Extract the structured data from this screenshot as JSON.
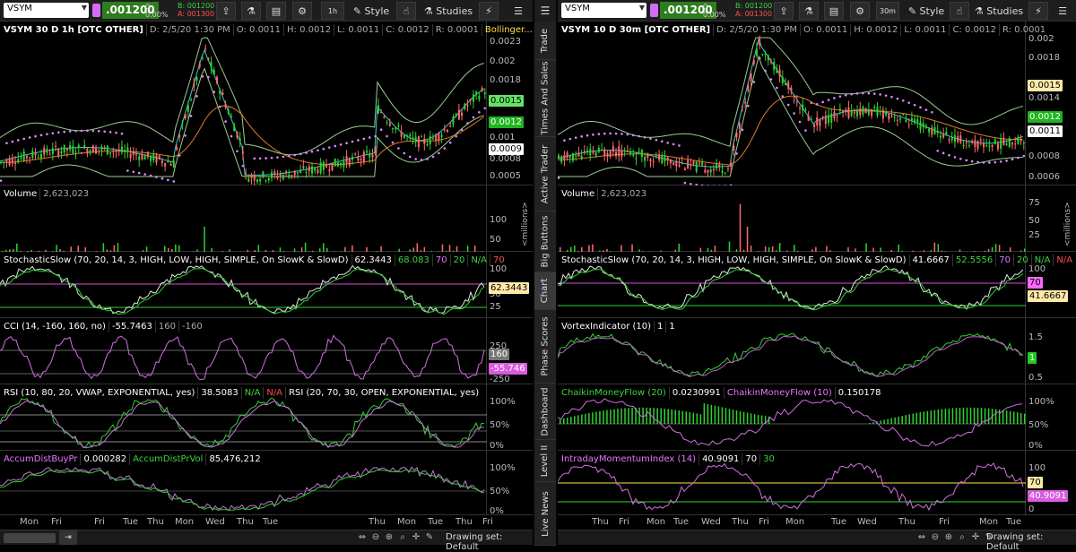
{
  "left": {
    "toolbar": {
      "symbol": "VSYM",
      "price": ".001200",
      "change": "0",
      "change_pct": "0.00%",
      "bid": "B: 001200",
      "ask": "A: 001300",
      "timeframe": "1h",
      "style_label": "Style",
      "studies_label": "Studies"
    },
    "price_pane": {
      "title": "VSYM 30 D 1h [OTC OTHER]",
      "date": "D: 2/5/20 1:30 PM",
      "open": "O: 0.0011",
      "high": "H: 0.0012",
      "low": "L: 0.0011",
      "close": "C: 0.0012",
      "range": "R: 0.0001",
      "study": "Bollinger...",
      "axis": [
        "0.0023",
        "0.002",
        "0.0018",
        "0.0015",
        "0.0012",
        "0.001",
        "0.0009",
        "0.0008",
        "0.0005"
      ],
      "tags": {
        "upper": "0.0015",
        "last": "0.0012",
        "lower": "0.0009"
      }
    },
    "volume_pane": {
      "label": "Volume",
      "value": "2,623,023",
      "axis": [
        "100",
        "50"
      ],
      "units": "<millions>"
    },
    "stoch_pane": {
      "label": "StochasticSlow (70, 20, 14, 3, HIGH, LOW, HIGH, SIMPLE, On SlowK & SlowD)",
      "k": "62.3443",
      "d": "68.083",
      "ob": "70",
      "os": "20",
      "na": "N/A",
      "ob2": "70",
      "axis": [
        "100",
        "50",
        "25"
      ],
      "tag": "62.3443"
    },
    "cci_pane": {
      "label": "CCI (14, -160, 160, no)",
      "value": "-55.7463",
      "high": "160",
      "low": "-160",
      "axis": [
        "250",
        "160",
        "-250"
      ],
      "tag": "-55.746",
      "tag_hi": "160"
    },
    "rsi_pane": {
      "label": "RSI (10, 80, 20, VWAP, EXPONENTIAL, yes)",
      "value": "38.5083",
      "na1": "N/A",
      "na2": "N/A",
      "label2": "RSI (20, 70, 30, OPEN, EXPONENTIAL, yes)",
      "axis": [
        "100%",
        "50%",
        "0%"
      ]
    },
    "ad_pane": {
      "label": "AccumDistBuyPr",
      "value": "0.000282",
      "label2": "AccumDistPrVol",
      "value2": "85,476,212",
      "axis": [
        "100%",
        "50%",
        "0%"
      ]
    },
    "xaxis": [
      "Mon",
      "Fri",
      "Fri",
      "Tue",
      "Thu",
      "Mon",
      "Wed",
      "Thu",
      "Tue",
      "Thu",
      "Mon",
      "Tue",
      "Thu",
      "Fri"
    ],
    "drawing_set": "Drawing set: Default"
  },
  "right": {
    "toolbar": {
      "symbol": "VSYM",
      "price": ".001200",
      "change": "0",
      "change_pct": "0.00%",
      "bid": "B: 001200",
      "ask": "A: 001300",
      "timeframe": "30m",
      "style_label": "Style",
      "studies_label": "Studies"
    },
    "price_pane": {
      "title": "VSYM 10 D 30m [OTC OTHER]",
      "date": "D: 2/5/20 1:30 PM",
      "open": "O: 0.0011",
      "high": "H: 0.0012",
      "low": "L: 0.0011",
      "close": "C: 0.0012",
      "range": "R: 0.0001",
      "axis": [
        "0.002",
        "0.0018",
        "0.0015",
        "0.0014",
        "0.0012",
        "0.0011",
        "0.0008",
        "0.0006"
      ],
      "tags": {
        "upper": "0.0015",
        "last": "0.0012",
        "lower": "0.0011"
      }
    },
    "volume_pane": {
      "label": "Volume",
      "value": "2,623,023",
      "axis": [
        "75",
        "50",
        "25"
      ],
      "units": "<millions>"
    },
    "stoch_pane": {
      "label": "StochasticSlow (70, 20, 14, 3, HIGH, LOW, HIGH, SIMPLE, On SlowK & SlowD)",
      "k": "41.6667",
      "d": "52.5556",
      "ob": "70",
      "os": "20",
      "na1": "N/A",
      "na2": "N/A",
      "axis": [
        "100",
        "50"
      ],
      "tag_ob": "70",
      "tag": "41.6667"
    },
    "vortex_pane": {
      "label": "VortexIndicator (10)",
      "v1": "1",
      "v2": "1",
      "axis": [
        "1.5",
        "1",
        "0.5"
      ],
      "tag": "1"
    },
    "cmf_pane": {
      "label": "ChaikinMoneyFlow (20)",
      "value": "0.0230991",
      "label2": "ChaikinMoneyFlow (10)",
      "value2": "0.150178",
      "axis": [
        "100%",
        "50%",
        "0%"
      ]
    },
    "imi_pane": {
      "label": "IntradayMomentumIndex (14)",
      "value": "40.9091",
      "ob": "70",
      "os": "30",
      "axis": [
        "100",
        "50",
        "0"
      ],
      "tag_ob": "70",
      "tag": "40.9091"
    },
    "xaxis": [
      "Thu",
      "Fri",
      "Mon",
      "Tue",
      "Wed",
      "Thu",
      "Fri",
      "Mon",
      "Tue",
      "Wed",
      "Thu",
      "Fri",
      "Mon",
      "Tue"
    ],
    "drawing_set": "Drawing set: Default"
  },
  "sidetabs": [
    "Trade",
    "Times And Sales",
    "Active Trader",
    "Big Buttons",
    "Chart",
    "Phase Scores",
    "Dashboard",
    "Level II",
    "Live News"
  ]
}
